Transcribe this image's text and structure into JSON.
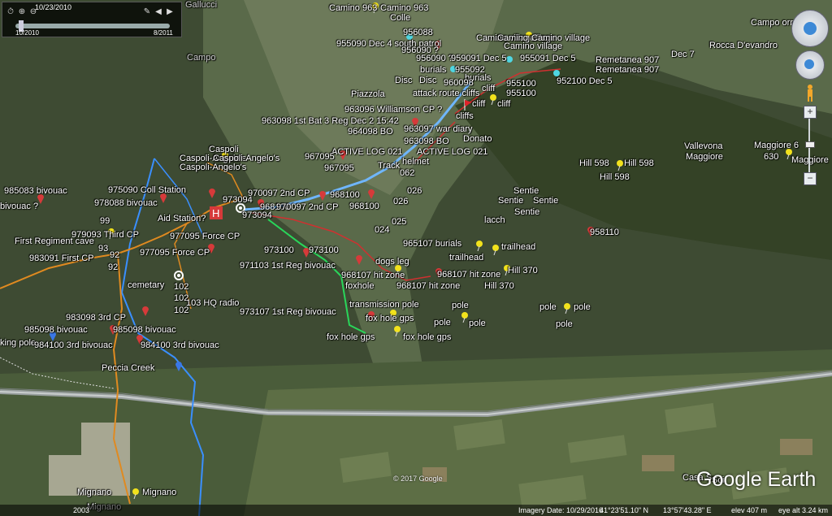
{
  "time_slider": {
    "current_date": "10/23/2010",
    "start": "10/2010",
    "end": "8/2011"
  },
  "status_bar": {
    "year": "2003",
    "imagery_date": "Imagery Date: 10/29/2016",
    "lat": "41°23'51.10\" N",
    "lon": "13°57'43.28\" E",
    "elev": "elev  407 m",
    "eye_alt": "eye alt  3.24 km"
  },
  "copyright": "© 2017 Google",
  "logo": "Google Earth",
  "colors": {
    "red_pin": "#d63a3a",
    "yellow_pin": "#f2e21c",
    "cyan_pin": "#4fd7e3",
    "blue_pin": "#3a77e6",
    "path_blue": "#6fb6ff",
    "path_orange": "#e08a20",
    "path_green": "#29d65a",
    "path_red": "#d03030"
  },
  "labels": [
    {
      "t": "Gallucci",
      "k": "gray"
    },
    {
      "t": "Camino 963",
      "k": "w"
    },
    {
      "t": "Camino 963",
      "k": "w"
    },
    {
      "t": "Colle",
      "k": "w"
    },
    {
      "t": "956088",
      "k": "w"
    },
    {
      "t": "955090 Dec 4 south patrol",
      "k": "w"
    },
    {
      "t": "956090 ?",
      "k": "w"
    },
    {
      "t": "956090 ?",
      "k": "w"
    },
    {
      "t": "959091 Dec 5",
      "k": "w"
    },
    {
      "t": "955091 Dec 5",
      "k": "w"
    },
    {
      "t": "Camino village",
      "k": "w"
    },
    {
      "t": "Camino village",
      "k": "w"
    },
    {
      "t": "Camino village",
      "k": "w"
    },
    {
      "t": "Camino village",
      "k": "w"
    },
    {
      "t": "Campo orno",
      "k": "w"
    },
    {
      "t": "Rocca D'evandro",
      "k": "w"
    },
    {
      "t": "Dec 7",
      "k": "w"
    },
    {
      "t": "Remetanea 907",
      "k": "w"
    },
    {
      "t": "Remetanea 907",
      "k": "w"
    },
    {
      "t": "burials",
      "k": "w"
    },
    {
      "t": "955092",
      "k": "w"
    },
    {
      "t": "burials",
      "k": "w"
    },
    {
      "t": "Disc",
      "k": "w"
    },
    {
      "t": "Disc",
      "k": "w"
    },
    {
      "t": "960098",
      "k": "w"
    },
    {
      "t": "cliff",
      "k": "w"
    },
    {
      "t": "955100",
      "k": "w"
    },
    {
      "t": "952100 Dec 5",
      "k": "w"
    },
    {
      "t": "955100",
      "k": "w"
    },
    {
      "t": "Piazzola",
      "k": "w"
    },
    {
      "t": "attack route cliffs",
      "k": "w"
    },
    {
      "t": "cliff",
      "k": "w"
    },
    {
      "t": "cliff",
      "k": "w"
    },
    {
      "t": "963096 Williamson CP ?",
      "k": "w"
    },
    {
      "t": "cliffs",
      "k": "w"
    },
    {
      "t": "963098 1st Bat 3 Reg Dec 2 15:42",
      "k": "w"
    },
    {
      "t": "963097 war diary",
      "k": "w"
    },
    {
      "t": "964098 BO",
      "k": "w"
    },
    {
      "t": "Donato",
      "k": "w"
    },
    {
      "t": "963098 BO",
      "k": "w"
    },
    {
      "t": "ACTIVE LOG 021",
      "k": "w"
    },
    {
      "t": "ACTIVE LOG 021",
      "k": "w"
    },
    {
      "t": "967095",
      "k": "w"
    },
    {
      "t": "967095",
      "k": "w"
    },
    {
      "t": "helmet",
      "k": "w"
    },
    {
      "t": "Track",
      "k": "w"
    },
    {
      "t": "062",
      "k": "w"
    },
    {
      "t": "Caspoli",
      "k": "w"
    },
    {
      "t": "Caspoli-Angelo's",
      "k": "w"
    },
    {
      "t": "Caspoli-Angelo's",
      "k": "w"
    },
    {
      "t": "Caspoli-Angelo's",
      "k": "w"
    },
    {
      "t": "985083 bivouac",
      "k": "w"
    },
    {
      "t": "975090 Coll Station",
      "k": "w"
    },
    {
      "t": "978088 bivouac",
      "k": "w"
    },
    {
      "t": "bivouac ?",
      "k": "w"
    },
    {
      "t": "Aid Station?",
      "k": "w"
    },
    {
      "t": "973094",
      "k": "w"
    },
    {
      "t": "973094",
      "k": "w"
    },
    {
      "t": "970097 2nd CP",
      "k": "w"
    },
    {
      "t": "968100",
      "k": "w"
    },
    {
      "t": "968100",
      "k": "w"
    },
    {
      "t": "970097 2nd CP",
      "k": "w"
    },
    {
      "t": "968100",
      "k": "w"
    },
    {
      "t": "026",
      "k": "w"
    },
    {
      "t": "026",
      "k": "w"
    },
    {
      "t": "025",
      "k": "w"
    },
    {
      "t": "024",
      "k": "w"
    },
    {
      "t": "99",
      "k": "w"
    },
    {
      "t": "979093 Third CP",
      "k": "w"
    },
    {
      "t": "977095 Force CP",
      "k": "w"
    },
    {
      "t": "First Regiment cave",
      "k": "w"
    },
    {
      "t": "93",
      "k": "w"
    },
    {
      "t": "92",
      "k": "w"
    },
    {
      "t": "977095 Force CP",
      "k": "w"
    },
    {
      "t": "983091 First CP",
      "k": "w"
    },
    {
      "t": "92",
      "k": "w"
    },
    {
      "t": "973100",
      "k": "w"
    },
    {
      "t": "973100",
      "k": "w"
    },
    {
      "t": "971103 1st Reg bivouac",
      "k": "w"
    },
    {
      "t": "dogs leg",
      "k": "w"
    },
    {
      "t": "965107 burials",
      "k": "w"
    },
    {
      "t": "trailhead",
      "k": "w"
    },
    {
      "t": "trailhead",
      "k": "w"
    },
    {
      "t": "968107 hit zone",
      "k": "w"
    },
    {
      "t": "968107 hit zone",
      "k": "w"
    },
    {
      "t": "Hill 370",
      "k": "w"
    },
    {
      "t": "foxhole",
      "k": "w"
    },
    {
      "t": "968107 hit zone",
      "k": "w"
    },
    {
      "t": "Hill 370",
      "k": "w"
    },
    {
      "t": "cemetary",
      "k": "w"
    },
    {
      "t": "102",
      "k": "w"
    },
    {
      "t": "102",
      "k": "w"
    },
    {
      "t": "102",
      "k": "w"
    },
    {
      "t": "103 HQ radio",
      "k": "w"
    },
    {
      "t": "transmission pole",
      "k": "w"
    },
    {
      "t": "pole",
      "k": "w"
    },
    {
      "t": "pole",
      "k": "w"
    },
    {
      "t": "pole",
      "k": "w"
    },
    {
      "t": "pole",
      "k": "w"
    },
    {
      "t": "973107 1st Reg bivouac",
      "k": "w"
    },
    {
      "t": "983098 3rd CP",
      "k": "w"
    },
    {
      "t": "fox hole gps",
      "k": "w"
    },
    {
      "t": "pole",
      "k": "w"
    },
    {
      "t": "pole",
      "k": "w"
    },
    {
      "t": "985098 bivouac",
      "k": "w"
    },
    {
      "t": "985098 bivouac",
      "k": "w"
    },
    {
      "t": "fox hole gps",
      "k": "w"
    },
    {
      "t": "fox hole gps",
      "k": "w"
    },
    {
      "t": "king pole",
      "k": "w"
    },
    {
      "t": "984100 3rd bivouac",
      "k": "w"
    },
    {
      "t": "984100 3rd bivouac",
      "k": "w"
    },
    {
      "t": "Peccia Creek",
      "k": "w"
    },
    {
      "t": "Sentie",
      "k": "w"
    },
    {
      "t": "Sentie",
      "k": "w"
    },
    {
      "t": "Sentie",
      "k": "w"
    },
    {
      "t": "Sentie",
      "k": "w"
    },
    {
      "t": "lacch",
      "k": "w"
    },
    {
      "t": "Hill 598",
      "k": "w"
    },
    {
      "t": "Hill 598",
      "k": "w"
    },
    {
      "t": "Hill 598",
      "k": "w"
    },
    {
      "t": "Vallevona",
      "k": "w"
    },
    {
      "t": "Maggiore",
      "k": "w"
    },
    {
      "t": "Maggiore 6",
      "k": "w"
    },
    {
      "t": "630",
      "k": "w"
    },
    {
      "t": "Maggiore",
      "k": "w"
    },
    {
      "t": "958110",
      "k": "w"
    },
    {
      "t": "Campo",
      "k": "gray"
    },
    {
      "t": "Mignano",
      "k": "w"
    },
    {
      "t": "Mignano",
      "k": "w"
    },
    {
      "t": "Mignano",
      "k": "w"
    },
    {
      "t": "Casa S",
      "k": "w"
    },
    {
      "t": "Sci",
      "k": "w"
    }
  ]
}
